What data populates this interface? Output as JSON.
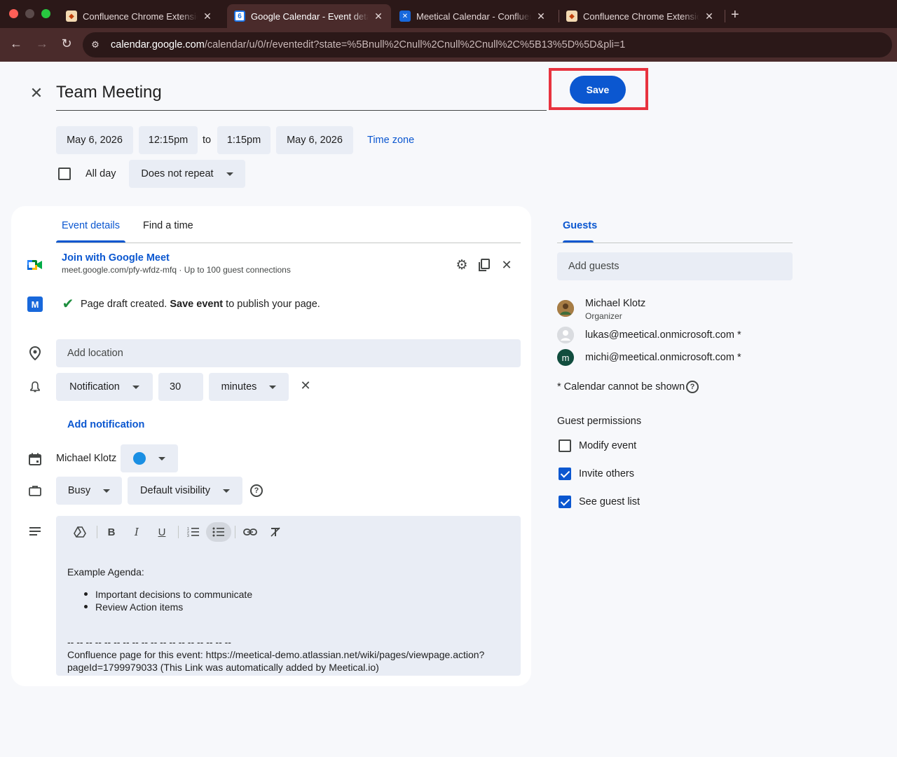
{
  "browser": {
    "tabs": [
      {
        "title": "Confluence Chrome Extension",
        "close": "✕"
      },
      {
        "title": "Google Calendar - Event details",
        "close": "✕"
      },
      {
        "title": "Meetical Calendar - Confluence",
        "close": "✕"
      },
      {
        "title": "Confluence Chrome Extension",
        "close": "✕"
      }
    ],
    "new_tab": "+",
    "url_host": "calendar.google.com",
    "url_path": "/calendar/u/0/r/eventedit?state=%5Bnull%2Cnull%2Cnull%2Cnull%2C%5B13%5D%5D&pli=1"
  },
  "event": {
    "title": "Team Meeting",
    "save_label": "Save",
    "start_date": "May 6, 2026",
    "start_time": "12:15pm",
    "to_label": "to",
    "end_time": "1:15pm",
    "end_date": "May 6, 2026",
    "time_zone": "Time zone",
    "all_day": "All day",
    "repeat": "Does not repeat"
  },
  "tabs": {
    "details": "Event details",
    "find_time": "Find a time"
  },
  "meet": {
    "join": "Join with Google Meet",
    "info": "meet.google.com/pfy-wfdz-mfq · Up to 100 guest connections"
  },
  "confluence": {
    "prefix": "Page draft created.",
    "bold": "Save event",
    "suffix": "to publish your page."
  },
  "location_placeholder": "Add location",
  "notification": {
    "type": "Notification",
    "amount": "30",
    "unit": "minutes",
    "add": "Add notification"
  },
  "calendar": {
    "owner": "Michael Klotz",
    "color": "#1a8fe3"
  },
  "availability": {
    "status": "Busy",
    "visibility": "Default visibility"
  },
  "description": {
    "heading": "Example Agenda:",
    "bullets": [
      "Important decisions to communicate",
      "Review Action items"
    ],
    "divider": "-- -- -- -- -- -- -- -- -- -- -- -- -- -- -- -- -- --",
    "line1": "Confluence page for this event: https://meetical-demo.atlassian.net/wiki/pages/viewpage.action?",
    "line2": "pageId=1799979033 (This Link was automatically added by Meetical.io)"
  },
  "guests": {
    "tab": "Guests",
    "placeholder": "Add guests",
    "list": [
      {
        "name": "Michael Klotz",
        "role": "Organizer"
      },
      {
        "name": "lukas@meetical.onmicrosoft.com *"
      },
      {
        "name": "michi@meetical.onmicrosoft.com *",
        "initial": "m"
      }
    ],
    "calendar_note": "* Calendar cannot be shown",
    "permissions_title": "Guest permissions",
    "permissions": [
      {
        "label": "Modify event",
        "checked": false
      },
      {
        "label": "Invite others",
        "checked": true
      },
      {
        "label": "See guest list",
        "checked": true
      }
    ]
  },
  "colors": {
    "accent": "#0b57d0",
    "highlight": "#e8333f",
    "field_bg": "#e9edf5"
  }
}
